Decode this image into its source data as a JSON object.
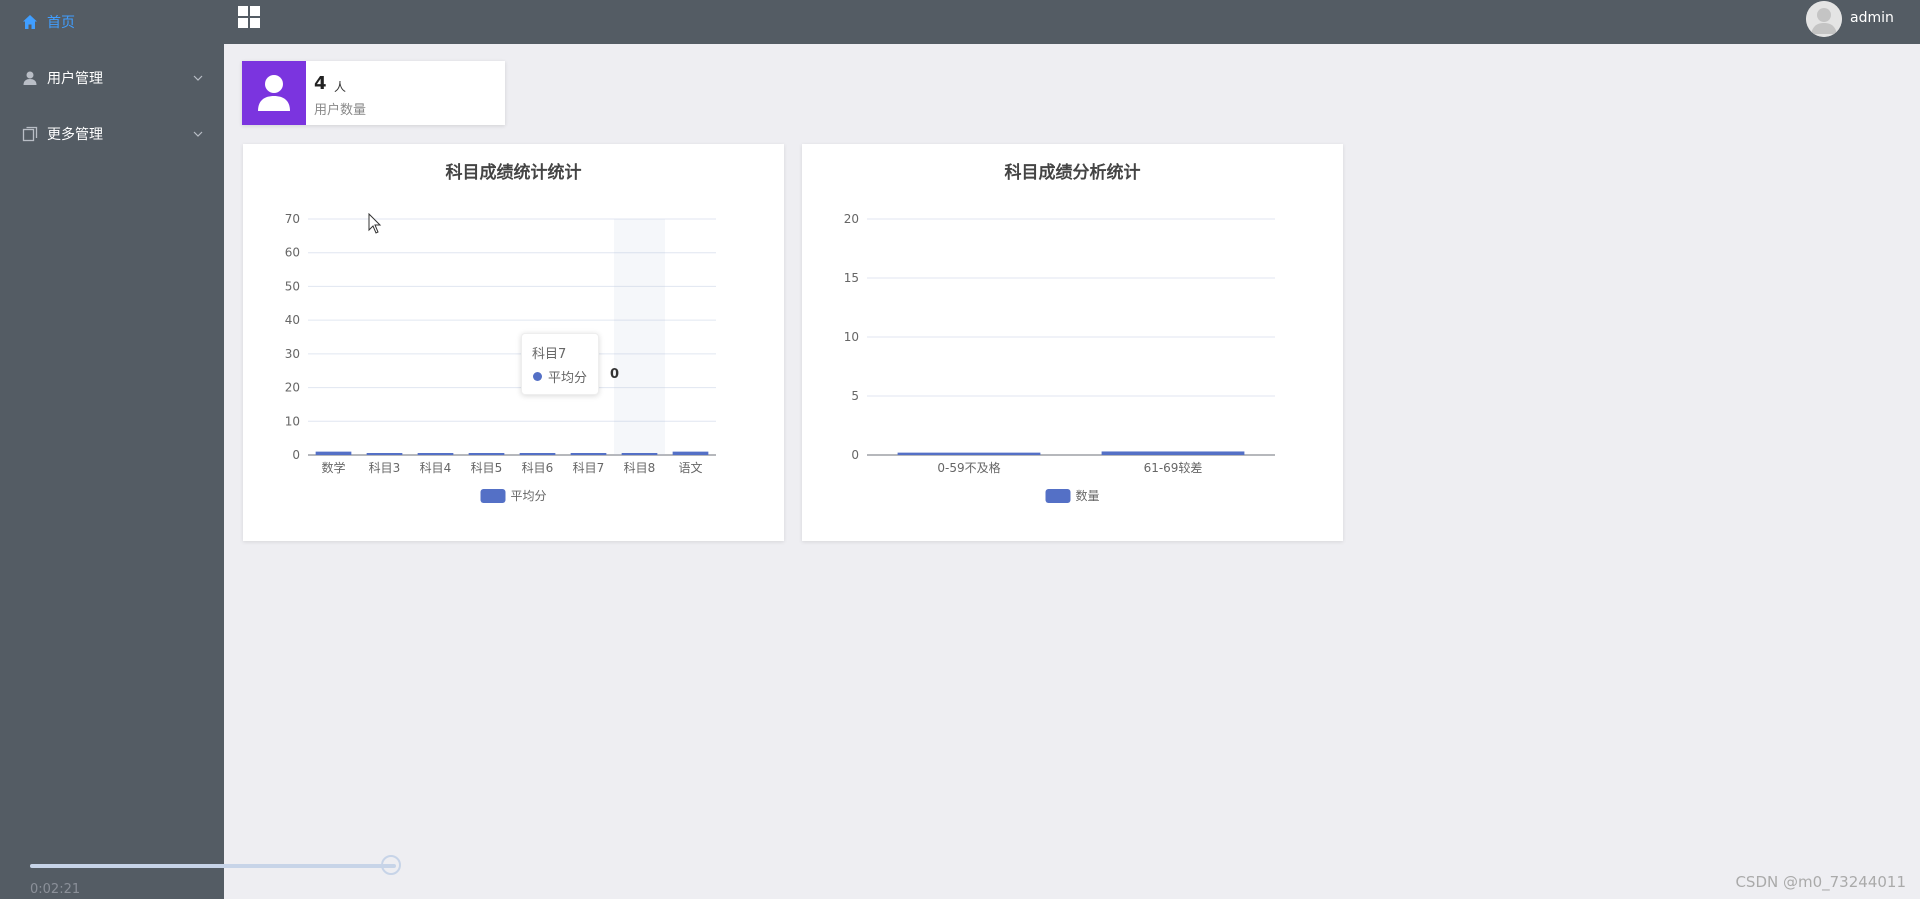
{
  "sidebar": {
    "items": [
      {
        "label": "首页",
        "icon": "home-icon",
        "active": true
      },
      {
        "label": "用户管理",
        "icon": "user-icon",
        "expandable": true
      },
      {
        "label": "更多管理",
        "icon": "copy-icon",
        "expandable": true
      }
    ]
  },
  "topbar": {
    "menu_icon": "grid-icon",
    "user": {
      "name": "admin",
      "avatar_icon": "avatar-icon"
    }
  },
  "stat_card": {
    "value": "4",
    "unit": "人",
    "label": "用户数量",
    "icon": "user-icon",
    "color": "#7b34df"
  },
  "chart_data": [
    {
      "type": "bar",
      "title": "科目成绩统计统计",
      "categories": [
        "数学",
        "科目3",
        "科目4",
        "科目5",
        "科目6",
        "科目7",
        "科目8",
        "语文"
      ],
      "series": [
        {
          "name": "平均分",
          "values": [
            1,
            0,
            0,
            0,
            0,
            0,
            0,
            1
          ]
        }
      ],
      "yticks": [
        "0",
        "10",
        "20",
        "30",
        "40",
        "50",
        "60",
        "70"
      ],
      "ylim": [
        0,
        70
      ],
      "grid": true,
      "legend_position": "bottom",
      "color": "#5470c6",
      "highlight_category": "科目8",
      "tooltip": {
        "title": "科目7",
        "series": "平均分",
        "value": "0"
      }
    },
    {
      "type": "bar",
      "title": "科目成绩分析统计",
      "categories": [
        "0-59不及格",
        "61-69较差"
      ],
      "series": [
        {
          "name": "数量",
          "values": [
            0.2,
            0.3
          ]
        }
      ],
      "yticks": [
        "0",
        "5",
        "10",
        "15",
        "20"
      ],
      "ylim": [
        0,
        20
      ],
      "grid": true,
      "legend_position": "bottom",
      "color": "#5470c6"
    }
  ],
  "player": {
    "time": "0:02:21",
    "progress": 0.96
  },
  "watermark": "CSDN @m0_73244011"
}
